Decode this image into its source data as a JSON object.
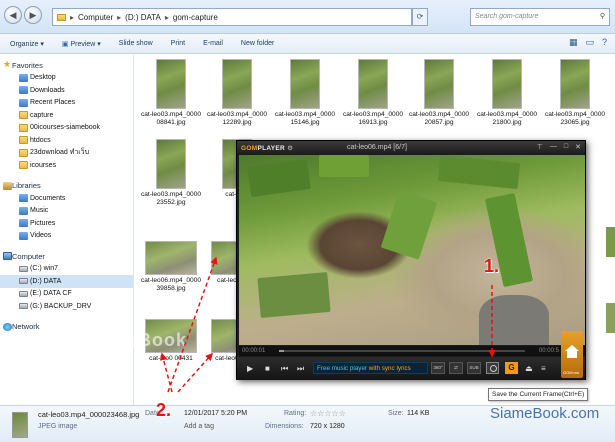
{
  "address_bar": {
    "back": "◀",
    "forward": "▶",
    "crumbs": [
      "Computer",
      "(D:) DATA",
      "gom-capture"
    ],
    "search_placeholder": "Search gom-capture"
  },
  "toolbar": {
    "organize": "Organize ▾",
    "preview": "Preview ▾",
    "slideshow": "Slide show",
    "print": "Print",
    "email": "E-mail",
    "new_folder": "New folder"
  },
  "sidebar": {
    "favorites_header": "Favorites",
    "favorites": [
      "Desktop",
      "Downloads",
      "Recent Places",
      "capture",
      "00icourses-siamebook",
      "htdocs",
      "23download ทำเว็บ",
      "icourses"
    ],
    "libraries_header": "Libraries",
    "libraries": [
      "Documents",
      "Music",
      "Pictures",
      "Videos"
    ],
    "computer_header": "Computer",
    "drives": [
      "(C:) win7",
      "(D:) DATA",
      "(E:) DATA CF",
      "(G:) BACKUP_DRV"
    ],
    "network_header": "Network"
  },
  "files": [
    "cat-leo03.mp4_000008841.jpg",
    "cat-leo03.mp4_000012289.jpg",
    "cat-leo03.mp4_000015146.jpg",
    "cat-leo03.mp4_000016913.jpg",
    "cat-leo03.mp4_000020857.jpg",
    "cat-leo03.mp4_000021800.jpg",
    "cat-leo03.mp4_000023065.jpg",
    "cat-leo03.mp4_000023552.jpg",
    "cat-leo0",
    "cat-leo06.mp4_000039858.jpg",
    "cat-leo0 0405",
    "cat-leo0 00431",
    "cat-leo0 00439"
  ],
  "gom": {
    "logo_a": "GOM",
    "logo_b": "PLAYER",
    "title": "cat-leo06.mp4  [6/7]",
    "time_current": "00:00:01",
    "time_total": "00:00:5",
    "promo_a": "Free music player",
    "promo_b": " with sync lyrics",
    "home_label": "GOM.ms",
    "small_btn_1": "360°",
    "small_btn_2": "SUB",
    "tooltip": "Save the Current Frame(Ctrl+E)"
  },
  "details": {
    "filename": "cat-leo03.mp4_000023468.jpg",
    "filetype": "JPEG image",
    "date_key": "Date",
    "date_val": "12/01/2017 5:20 PM",
    "tags_val": "Add a tag",
    "rating_key": "Rating:",
    "stars": "☆☆☆☆☆",
    "dimensions_key": "Dimensions:",
    "dimensions_val": "720 x 1280",
    "size_key": "Size:",
    "size_val": "114 KB"
  },
  "annotations": {
    "one": "1.",
    "two": "2."
  },
  "watermark": "SiameBook.com",
  "watermark_overlay": "SiameBook"
}
